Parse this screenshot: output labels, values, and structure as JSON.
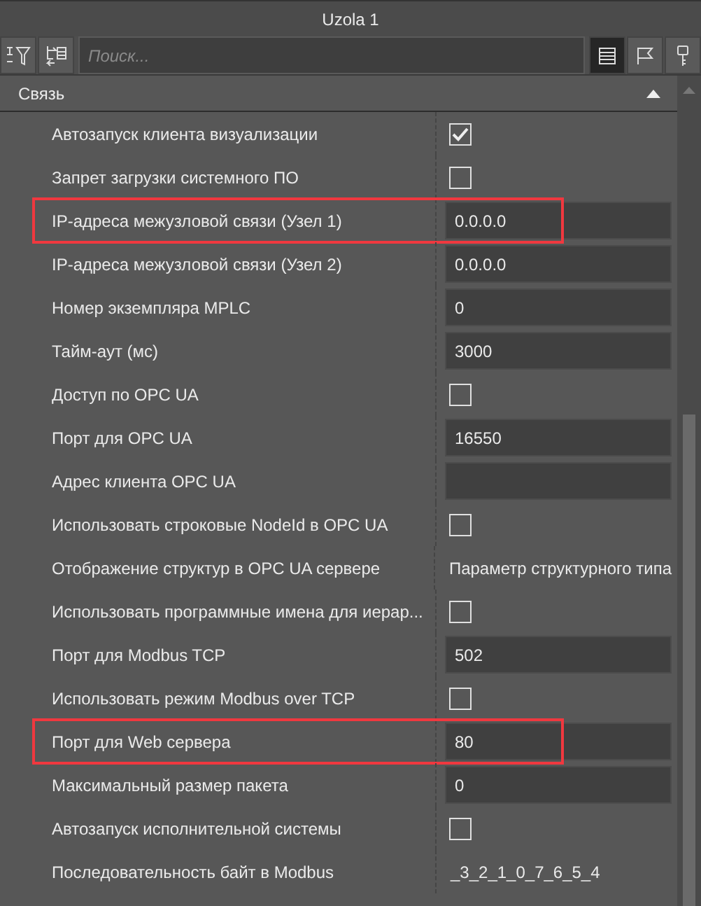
{
  "window": {
    "title": "Uzola 1"
  },
  "toolbar": {
    "search": {
      "placeholder": "Поиск..."
    },
    "view_buttons": [
      {
        "kind": "list",
        "selected": true
      },
      {
        "kind": "flag",
        "selected": false
      },
      {
        "kind": "key",
        "selected": false
      }
    ]
  },
  "section": {
    "title": "Связь",
    "expanded": true
  },
  "properties": [
    {
      "label": "Автозапуск клиента визуализации",
      "kind": "checkbox",
      "checked": true,
      "highlighted": false
    },
    {
      "label": "Запрет загрузки системного ПО",
      "kind": "checkbox",
      "checked": false,
      "highlighted": false
    },
    {
      "label": "IP-адреса межузловой связи (Узел 1)",
      "kind": "field",
      "value": "0.0.0.0",
      "highlighted": true
    },
    {
      "label": "IP-адреса межузловой связи (Узел 2)",
      "kind": "field",
      "value": "0.0.0.0",
      "highlighted": false
    },
    {
      "label": "Номер экземпляра MPLC",
      "kind": "field",
      "value": "0",
      "highlighted": false
    },
    {
      "label": "Тайм-аут (мс)",
      "kind": "field",
      "value": "3000",
      "highlighted": false
    },
    {
      "label": "Доступ по OPC UA",
      "kind": "checkbox",
      "checked": false,
      "highlighted": false
    },
    {
      "label": "Порт для OPC UA",
      "kind": "field",
      "value": "16550",
      "highlighted": false
    },
    {
      "label": "Адрес клиента OPC UA",
      "kind": "field",
      "highlighted": false
    },
    {
      "label": "Использовать строковые NodeId в OPC UA",
      "kind": "checkbox",
      "checked": false,
      "highlighted": false
    },
    {
      "label": "Отображение структур в OPC UA сервере",
      "kind": "text",
      "value": "Параметр структурного типа",
      "highlighted": false
    },
    {
      "label": "Использовать программные имена для иерар...",
      "kind": "checkbox",
      "checked": false,
      "highlighted": false
    },
    {
      "label": "Порт для Modbus TCP",
      "kind": "field",
      "value": "502",
      "highlighted": false
    },
    {
      "label": "Использовать режим Modbus over TCP",
      "kind": "checkbox",
      "checked": false,
      "highlighted": false
    },
    {
      "label": "Порт для Web сервера",
      "kind": "field",
      "value": "80",
      "highlighted": true
    },
    {
      "label": "Максимальный размер пакета",
      "kind": "field",
      "value": "0",
      "highlighted": false
    },
    {
      "label": "Автозапуск исполнительной системы",
      "kind": "checkbox",
      "checked": false,
      "highlighted": false
    },
    {
      "label": "Последовательность байт в Modbus",
      "kind": "text",
      "value": "_3_2_1_0_7_6_5_4",
      "highlighted": false
    }
  ]
}
